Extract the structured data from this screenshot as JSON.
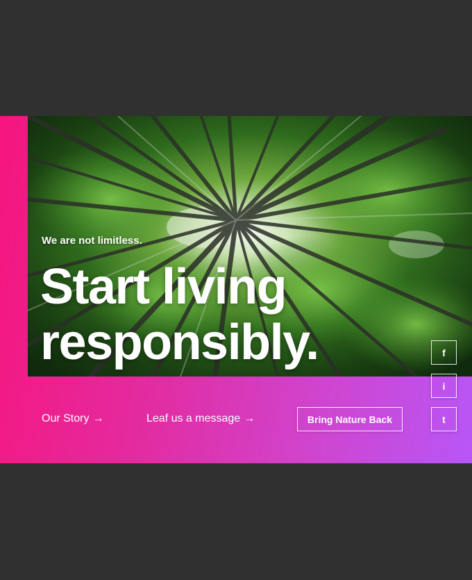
{
  "hero": {
    "tagline": "We are not limitless.",
    "headline_line1": "Start living",
    "headline_line2": "responsibly.",
    "image_subject": "bamboo-forest-canopy",
    "gradient_start": "#f7157d",
    "gradient_end": "#b856f6"
  },
  "footer_nav": {
    "our_story": "Our Story",
    "leave_message": "Leaf us a message",
    "arrow": "→",
    "cta": "Bring Nature Back"
  },
  "social": {
    "facebook": "f",
    "instagram": "i",
    "twitter": "t"
  },
  "colors": {
    "page_background": "#313031",
    "text": "#ffffff"
  }
}
